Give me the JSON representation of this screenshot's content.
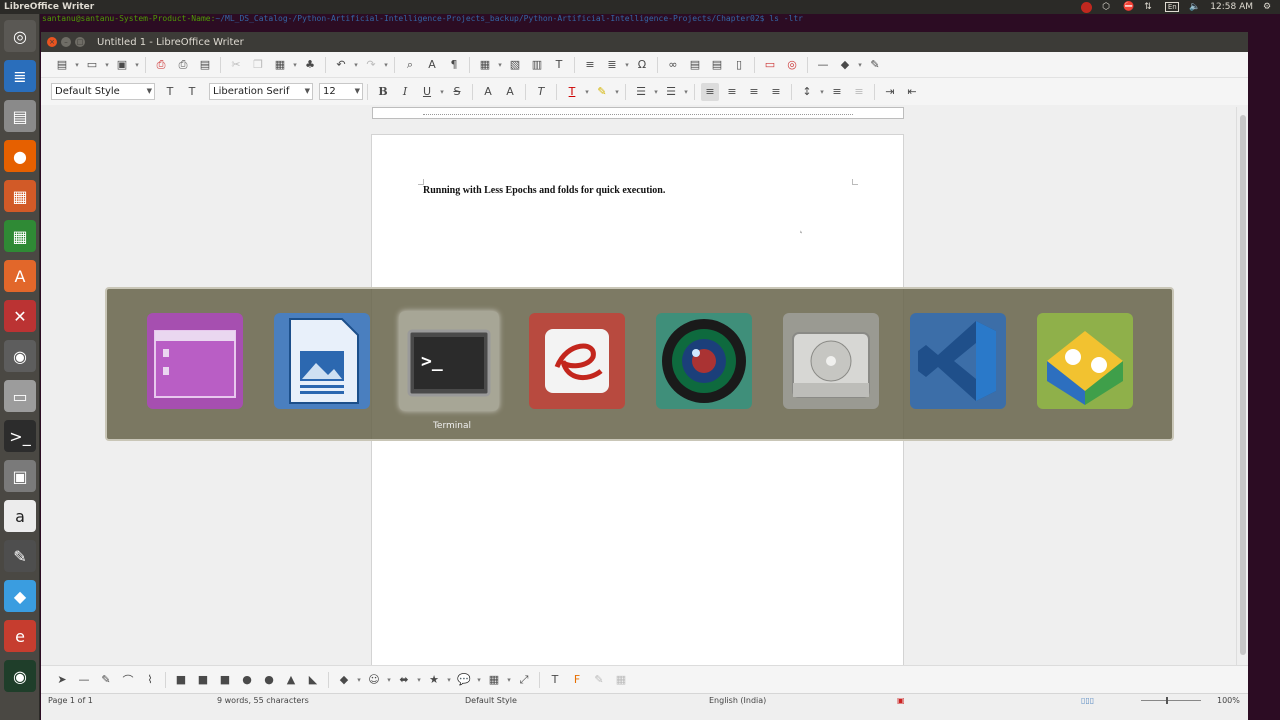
{
  "top_panel": {
    "app_title": "LibreOffice Writer",
    "clock": "12:58 AM",
    "keyboard_layout": "En"
  },
  "terminal": {
    "prompt_user": "santanu@santanu-System-Product-Name:",
    "prompt_path": "~/ML_DS_Catalog-/Python-Artificial-Intelligence-Projects_backup/Python-Artificial-Intelligence-Projects/Chapter02$ ls -ltr"
  },
  "window": {
    "title": "Untitled 1 - LibreOffice Writer"
  },
  "formatting": {
    "paragraph_style": "Default Style",
    "font_name": "Liberation Serif",
    "font_size": "12"
  },
  "document": {
    "text": "Running with Less Epochs and folds for quick execution."
  },
  "statusbar": {
    "page": "Page 1 of 1",
    "words": "9 words, 55 characters",
    "style": "Default Style",
    "language": "English (India)",
    "zoom": "100%"
  },
  "switcher": {
    "active_label": "Terminal",
    "apps": [
      {
        "name": "libreoffice-base-icon"
      },
      {
        "name": "libreoffice-draw-icon"
      },
      {
        "name": "terminal-icon"
      },
      {
        "name": "evince-icon"
      },
      {
        "name": "cheese-camera-icon"
      },
      {
        "name": "disks-icon"
      },
      {
        "name": "vscode-icon"
      },
      {
        "name": "anaconda-navigator-icon"
      }
    ]
  }
}
